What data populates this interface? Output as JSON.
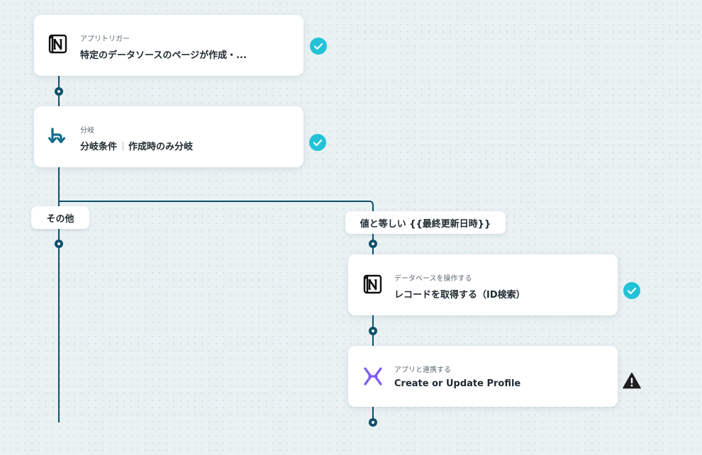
{
  "flow": {
    "steps": [
      {
        "id": "trigger",
        "app_icon": "notion-icon",
        "subtitle": "アプリトリガー",
        "title": "特定のデータソースのページが作成・...",
        "status": "complete"
      },
      {
        "id": "branch",
        "app_icon": "branch-icon",
        "subtitle": "分岐",
        "title_main": "分岐条件",
        "title_detail": "作成時のみ分岐",
        "status": "complete"
      },
      {
        "id": "get-record",
        "app_icon": "notion-icon",
        "subtitle": "データベースを操作する",
        "title": "レコードを取得する（ID検索）",
        "status": "complete"
      },
      {
        "id": "create-profile",
        "app_icon": "klaviyo-x-icon",
        "subtitle": "アプリと連携する",
        "title": "Create or Update Profile",
        "status": "warning"
      }
    ],
    "branches": {
      "else_label": "その他",
      "match_label": "値と等しい {{最終更新日時}}"
    }
  },
  "colors": {
    "connector": "#0d4f6b",
    "check": "#22c3d6",
    "warning": "#1f1f1f",
    "branch_icon": "#0f6b8a",
    "x_icon": "#7b5cf5"
  }
}
